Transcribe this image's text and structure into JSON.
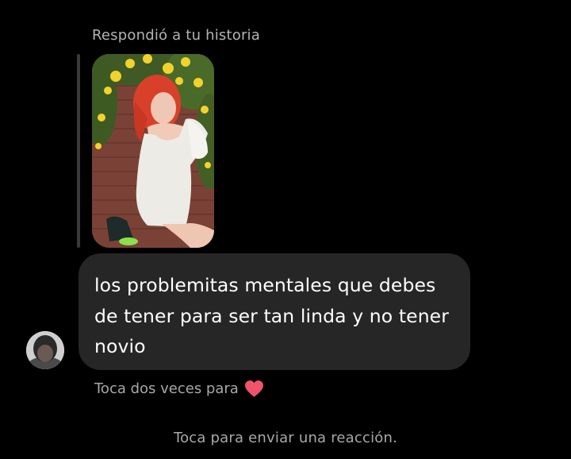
{
  "story_reply": {
    "label": "Respondió a tu historia",
    "thumbnail": "story-photo-thumbnail"
  },
  "message": {
    "text": "los problemitas mentales que debes de tener para ser tan linda y no tener novio",
    "bubble_color": "#262626",
    "text_color": "#ffffff"
  },
  "sender": {
    "avatar": "user-avatar"
  },
  "hints": {
    "double_tap": "Toca dos veces para",
    "double_tap_icon": "heart-icon",
    "heart_color": "#ed4956",
    "reaction": "Toca para enviar una reacción."
  }
}
